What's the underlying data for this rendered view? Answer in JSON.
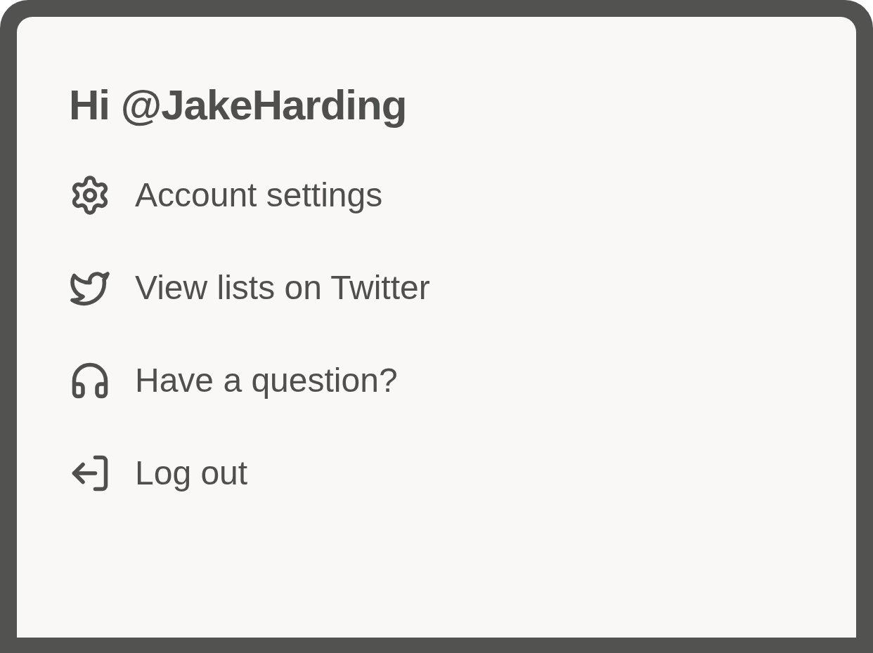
{
  "greeting": "Hi @JakeHarding",
  "menu": [
    {
      "kind": "settings",
      "label": "Account settings"
    },
    {
      "kind": "twitter",
      "label": "View lists on Twitter"
    },
    {
      "kind": "help",
      "label": "Have a question?"
    },
    {
      "kind": "logout",
      "label": "Log out"
    }
  ]
}
